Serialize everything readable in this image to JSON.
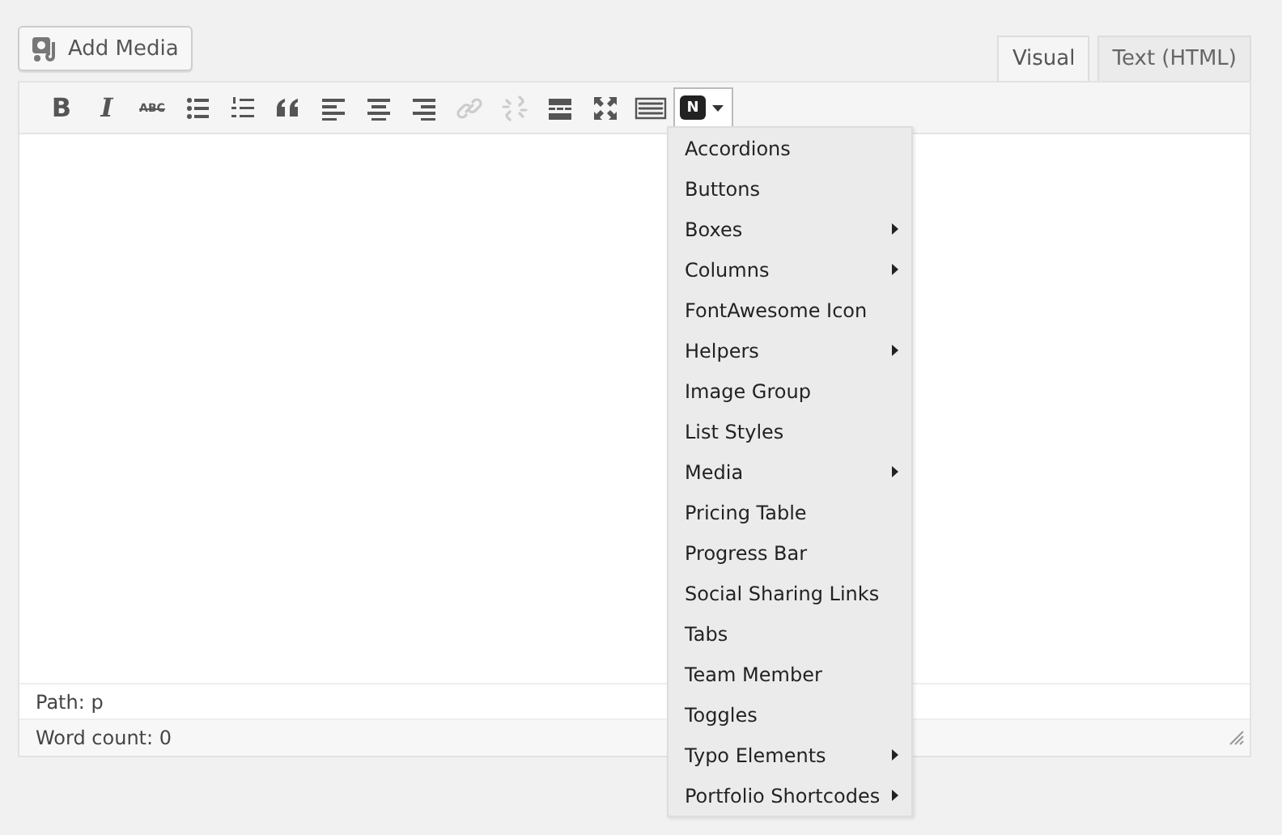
{
  "add_media_button": {
    "label": "Add Media"
  },
  "editor_tabs": [
    {
      "label": "Visual",
      "selected": true
    },
    {
      "label": "Text (HTML)",
      "selected": false
    }
  ],
  "toolbar": [
    {
      "kind": "bold",
      "glyph": "B",
      "disabled": false
    },
    {
      "kind": "italic",
      "glyph": "I",
      "disabled": false
    },
    {
      "kind": "strike",
      "glyph": "ABC",
      "disabled": false
    },
    {
      "kind": "bullets",
      "disabled": false
    },
    {
      "kind": "numbers",
      "disabled": false
    },
    {
      "kind": "quote",
      "disabled": false
    },
    {
      "kind": "align-left",
      "disabled": false
    },
    {
      "kind": "align-center",
      "disabled": false
    },
    {
      "kind": "align-right",
      "disabled": false
    },
    {
      "kind": "link",
      "disabled": true
    },
    {
      "kind": "unlink",
      "disabled": true
    },
    {
      "kind": "more",
      "disabled": false
    },
    {
      "kind": "fullscreen",
      "disabled": false
    },
    {
      "kind": "kitchen-sink",
      "disabled": false
    },
    {
      "kind": "shortcodes",
      "glyph": "N",
      "disabled": false,
      "expanded": true
    }
  ],
  "shortcode_menu": [
    {
      "label": "Accordions",
      "has_submenu": false
    },
    {
      "label": "Buttons",
      "has_submenu": false
    },
    {
      "label": "Boxes",
      "has_submenu": true
    },
    {
      "label": "Columns",
      "has_submenu": true
    },
    {
      "label": "FontAwesome Icon",
      "has_submenu": false
    },
    {
      "label": "Helpers",
      "has_submenu": true
    },
    {
      "label": "Image Group",
      "has_submenu": false
    },
    {
      "label": "List Styles",
      "has_submenu": false
    },
    {
      "label": "Media",
      "has_submenu": true
    },
    {
      "label": "Pricing Table",
      "has_submenu": false
    },
    {
      "label": "Progress Bar",
      "has_submenu": false
    },
    {
      "label": "Social Sharing Links",
      "has_submenu": false
    },
    {
      "label": "Tabs",
      "has_submenu": false
    },
    {
      "label": "Team Member",
      "has_submenu": false
    },
    {
      "label": "Toggles",
      "has_submenu": false
    },
    {
      "label": "Typo Elements",
      "has_submenu": true
    },
    {
      "label": "Portfolio Shortcodes",
      "has_submenu": true
    }
  ],
  "path_bar": {
    "text": "Path: p"
  },
  "status_bar": {
    "word_count": "Word count: 0"
  }
}
